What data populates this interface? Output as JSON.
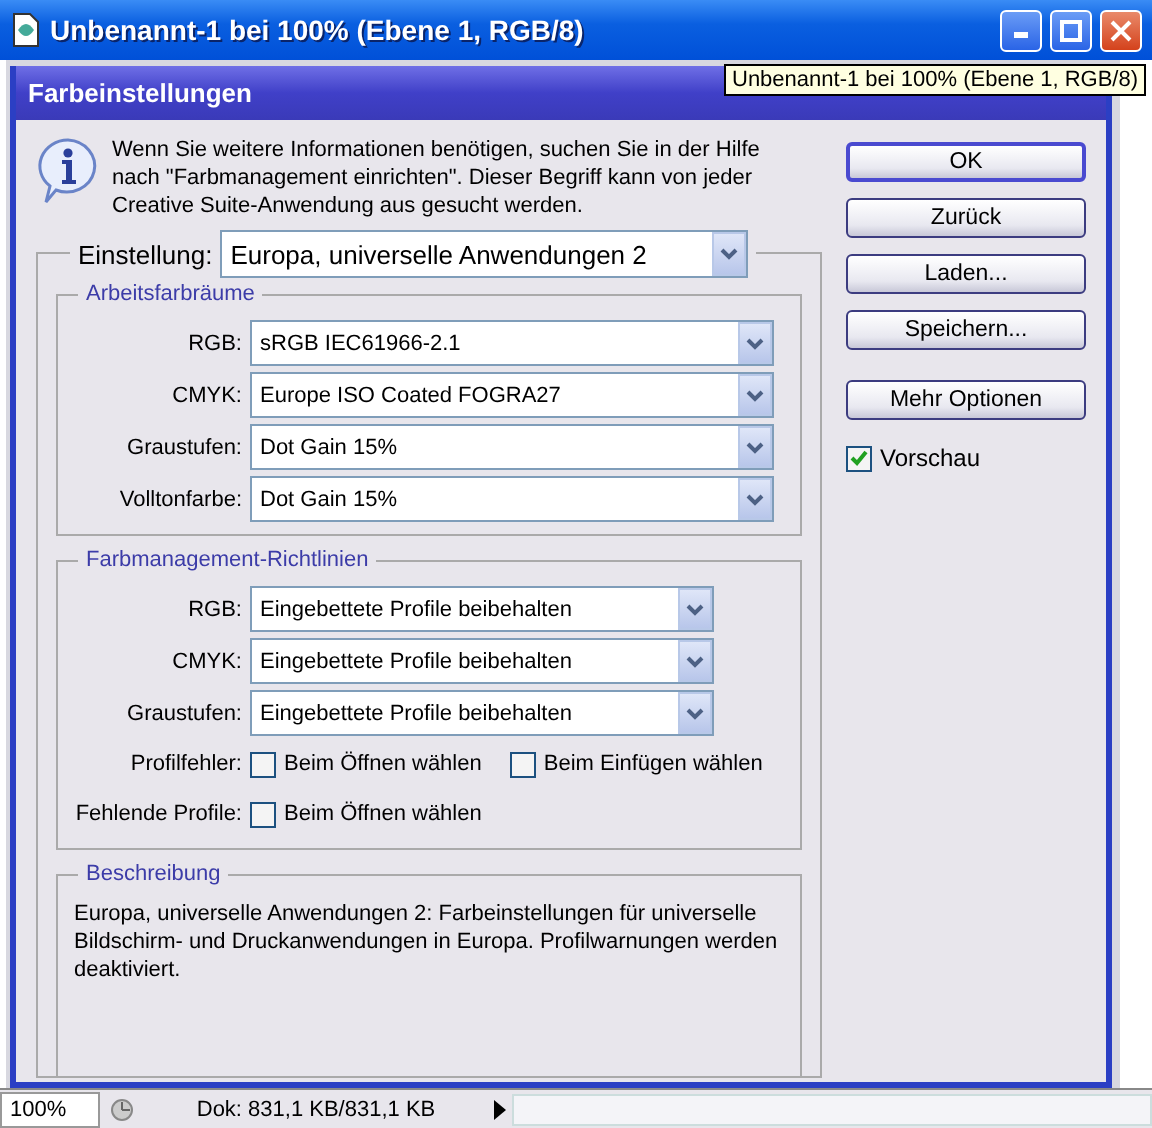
{
  "window": {
    "title": "Unbenannt-1 bei 100% (Ebene 1, RGB/8)"
  },
  "tooltip": "Unbenannt-1 bei 100% (Ebene 1, RGB/8)",
  "dialog": {
    "title": "Farbeinstellungen",
    "info": "Wenn Sie weitere Informationen benötigen, suchen Sie in der Hilfe nach \"Farbmanagement einrichten\". Dieser Begriff kann von jeder Creative Suite-Anwendung aus gesucht werden.",
    "setting": {
      "label": "Einstellung:",
      "value": "Europa, universelle Anwendungen 2"
    },
    "groups": [
      {
        "title": "Arbeitsfarbräume",
        "rows": [
          {
            "kind": "select",
            "label": "RGB:",
            "value": "sRGB IEC61966-2.1"
          },
          {
            "kind": "select",
            "label": "CMYK:",
            "value": "Europe ISO Coated FOGRA27"
          },
          {
            "kind": "select",
            "label": "Graustufen:",
            "value": "Dot Gain 15%"
          },
          {
            "kind": "select",
            "label": "Volltonfarbe:",
            "value": "Dot Gain 15%"
          }
        ]
      },
      {
        "title": "Farbmanagement-Richtlinien",
        "rows": [
          {
            "kind": "select",
            "label": "RGB:",
            "value": "Eingebettete Profile beibehalten"
          },
          {
            "kind": "select",
            "label": "CMYK:",
            "value": "Eingebettete Profile beibehalten"
          },
          {
            "kind": "select",
            "label": "Graustufen:",
            "value": "Eingebettete Profile beibehalten"
          },
          {
            "kind": "checkboxes",
            "label": "Profilfehler:",
            "options": [
              {
                "label": "Beim Öffnen wählen",
                "checked": false
              },
              {
                "label": "Beim Einfügen wählen",
                "checked": false
              }
            ]
          },
          {
            "kind": "checkboxes",
            "label": "Fehlende Profile:",
            "options": [
              {
                "label": "Beim Öffnen wählen",
                "checked": false
              }
            ]
          }
        ]
      }
    ],
    "description": {
      "title": "Beschreibung",
      "text": "Europa, universelle Anwendungen 2:  Farbeinstellungen für universelle Bildschirm- und Druckanwendungen in Europa. Profilwarnungen werden deaktiviert."
    },
    "buttons": [
      {
        "label": "OK",
        "default": true
      },
      {
        "label": "Zurück",
        "default": false
      },
      {
        "label": "Laden...",
        "default": false
      },
      {
        "label": "Speichern...",
        "default": false
      },
      {
        "label": "Mehr Optionen",
        "default": false
      }
    ],
    "preview": {
      "label": "Vorschau",
      "checked": true
    }
  },
  "status_bar": {
    "zoom": "100%",
    "document": "Dok: 831,1 KB/831,1 KB"
  }
}
